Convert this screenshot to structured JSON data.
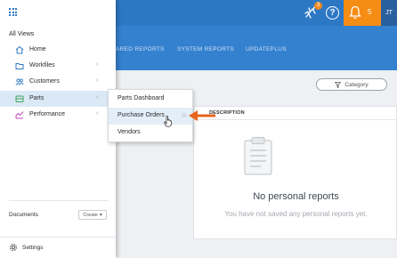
{
  "topbar": {
    "notification_badge": "3",
    "help_label": "?",
    "alerts_count": "5",
    "user_initials": "JT"
  },
  "subnav": {
    "tabs": [
      "ARED REPORTS",
      "SYSTEM REPORTS",
      "UPDATEPLUS"
    ]
  },
  "toolbar": {
    "category_label": "Category"
  },
  "reports_table": {
    "column_description": "DESCRIPTION",
    "empty_title": "No personal reports",
    "empty_subtitle": "You have not saved any personal reports yet."
  },
  "sidebar": {
    "views_title": "All Views",
    "items": [
      {
        "label": "Home",
        "icon": "home-icon"
      },
      {
        "label": "Workfiles",
        "icon": "folder-icon"
      },
      {
        "label": "Customers",
        "icon": "customers-icon"
      },
      {
        "label": "Parts",
        "icon": "parts-icon"
      },
      {
        "label": "Performance",
        "icon": "performance-icon"
      }
    ],
    "documents_label": "Documents",
    "create_label": "Create",
    "settings_label": "Settings"
  },
  "parts_submenu": {
    "items": [
      "Parts Dashboard",
      "Purchase Orders",
      "Vendors"
    ]
  },
  "colors": {
    "brand_blue": "#2d78c5",
    "alert_orange": "#f58c14",
    "arrow_orange": "#e8641c",
    "active_row": "#dbe9f6"
  }
}
